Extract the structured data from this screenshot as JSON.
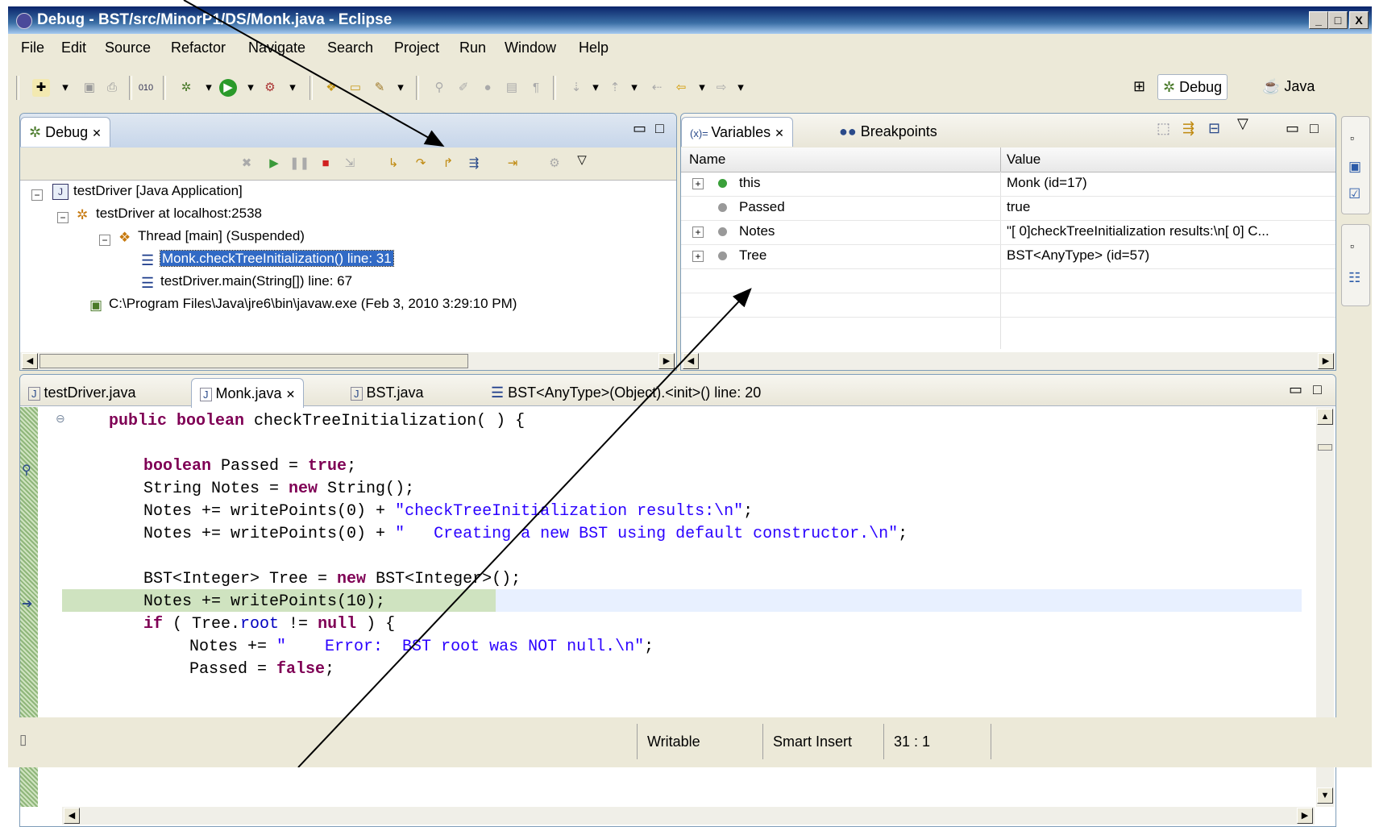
{
  "window": {
    "title": "Debug - BST/src/MinorP1/DS/Monk.java - Eclipse",
    "minimize": "_",
    "maximize": "□",
    "close": "X"
  },
  "menu": [
    "File",
    "Edit",
    "Source",
    "Refactor",
    "Navigate",
    "Search",
    "Project",
    "Run",
    "Window",
    "Help"
  ],
  "perspectives": {
    "debug": "Debug",
    "java": "Java"
  },
  "debug_view": {
    "tab": "Debug",
    "tree": [
      "testDriver [Java Application]",
      "testDriver at localhost:2538",
      "Thread [main] (Suspended)",
      "Monk.checkTreeInitialization() line: 31",
      "testDriver.main(String[]) line: 67",
      "C:\\Program Files\\Java\\jre6\\bin\\javaw.exe (Feb 3, 2010 3:29:10 PM)"
    ]
  },
  "variables_view": {
    "tab": "Variables",
    "tab2": "Breakpoints",
    "col_name": "Name",
    "col_value": "Value",
    "rows": [
      {
        "name": "this",
        "value": "Monk  (id=17)"
      },
      {
        "name": "Passed",
        "value": "true"
      },
      {
        "name": "Notes",
        "value": "\"[ 0]checkTreeInitialization results:\\n[ 0]   C..."
      },
      {
        "name": "Tree",
        "value": "BST<AnyType>  (id=57)"
      }
    ]
  },
  "editor": {
    "tabs": [
      "testDriver.java",
      "Monk.java",
      "BST.java",
      "BST<AnyType>(Object).<init>() line: 20"
    ]
  },
  "status": {
    "mode": "Writable",
    "insert": "Smart Insert",
    "position": "31 : 1"
  },
  "colors": {
    "title_bar": "#0a246a",
    "chrome": "#ece9d8",
    "current_line": "#cfe3c0",
    "keyword": "#7f0055",
    "string": "#2a00ff"
  }
}
